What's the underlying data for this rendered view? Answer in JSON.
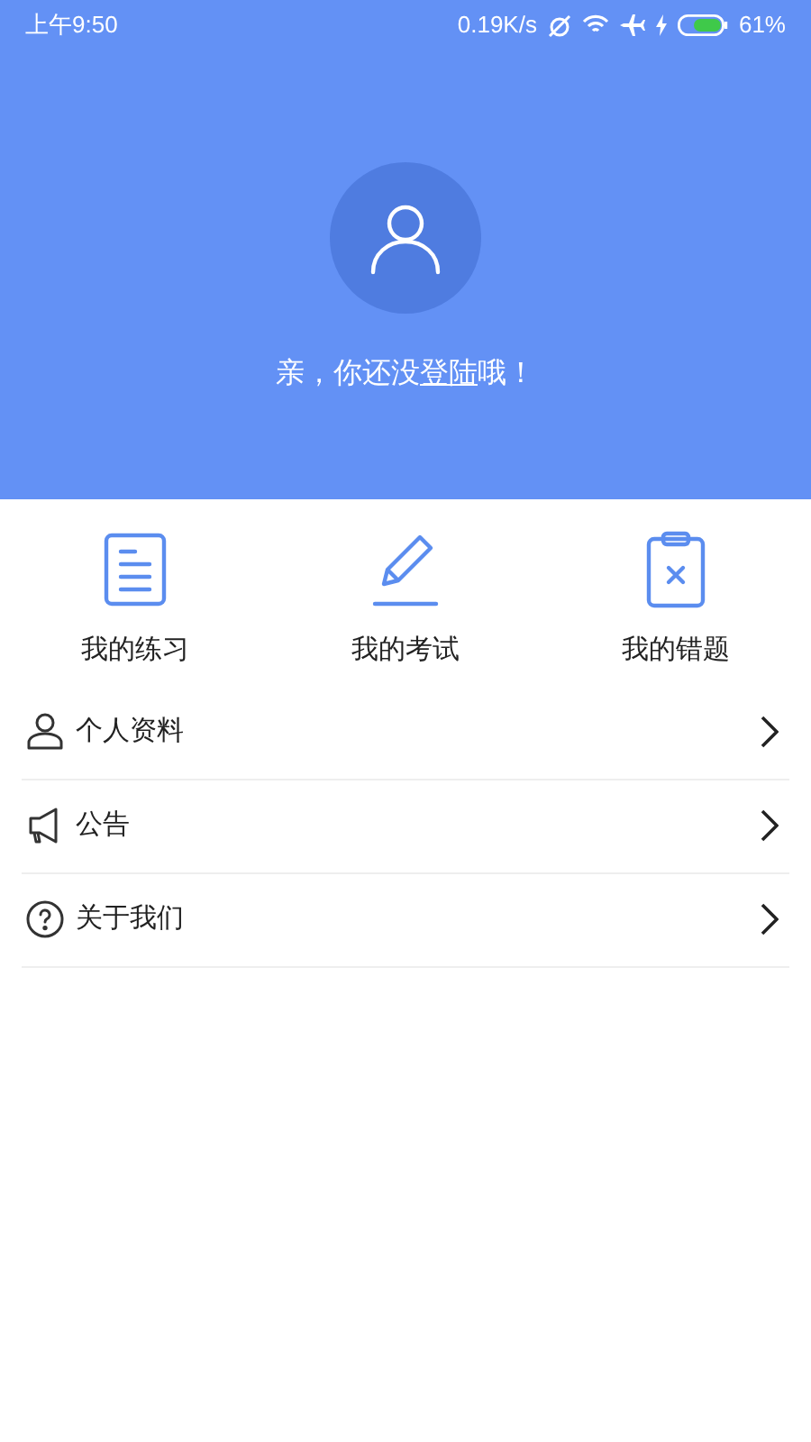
{
  "status_bar": {
    "time": "上午9:50",
    "speed": "0.19K/s",
    "battery": "61%"
  },
  "header": {
    "prompt_before": "亲，你还没",
    "login_link": "登陆",
    "prompt_after": "哦！"
  },
  "shortcuts": [
    {
      "kind": "document",
      "label": "我的练习"
    },
    {
      "kind": "pencil",
      "label": "我的考试"
    },
    {
      "kind": "clipboard",
      "label": "我的错题"
    }
  ],
  "menu": [
    {
      "kind": "user",
      "label": "个人资料"
    },
    {
      "kind": "megaphone",
      "label": "公告"
    },
    {
      "kind": "help",
      "label": "关于我们"
    }
  ]
}
